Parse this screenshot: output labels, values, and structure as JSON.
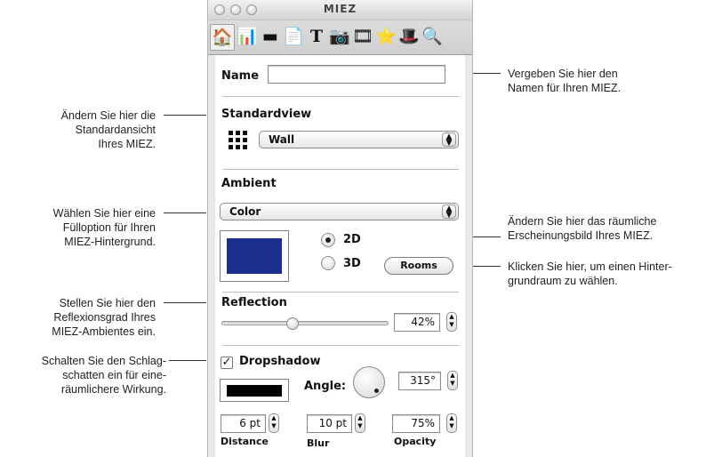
{
  "window": {
    "title": "MIEZ"
  },
  "toolbar": {
    "tools": [
      {
        "name": "home-tool",
        "glyph": "🏠",
        "selected": true
      },
      {
        "name": "floor-tool",
        "glyph": "📊",
        "selected": false
      },
      {
        "name": "table-tool",
        "glyph": "▬",
        "selected": false
      },
      {
        "name": "page-tool",
        "glyph": "📄",
        "selected": false
      },
      {
        "name": "text-tool",
        "glyph": "T",
        "selected": false
      },
      {
        "name": "photo-tool",
        "glyph": "📷",
        "selected": false
      },
      {
        "name": "film-tool",
        "glyph": "🎞",
        "selected": false
      },
      {
        "name": "star-tool",
        "glyph": "⭐",
        "selected": false
      },
      {
        "name": "magic-tool",
        "glyph": "🎩",
        "selected": false
      },
      {
        "name": "search-tool",
        "glyph": "🔍",
        "selected": false
      }
    ]
  },
  "panel": {
    "name_label": "Name",
    "name_value": "",
    "standardview_label": "Standardview",
    "standardview_value": "Wall",
    "ambient_label": "Ambient",
    "ambient_value": "Color",
    "ambient_color": "#1b2f8c",
    "radio_2d": "2D",
    "radio_3d": "3D",
    "radio_selected": "2D",
    "rooms_button": "Rooms",
    "reflection_label": "Reflection",
    "reflection_value": "42%",
    "reflection_level": 0.42,
    "dropshadow_label": "Dropshadow",
    "dropshadow_checked": true,
    "shadow_color": "#000000",
    "angle_label": "Angle:",
    "angle_value": "315°",
    "distance_value": "6 pt",
    "distance_label": "Distance",
    "blur_value": "10 pt",
    "blur_label": "Blur",
    "opacity_value": "75%",
    "opacity_label": "Opacity"
  },
  "annotations": {
    "name": "Vergeben Sie hier den\nNamen für Ihren MIEZ.",
    "standardview": "Ändern Sie hier die\nStandardansicht\nIhres MIEZ.",
    "ambient": "Wählen Sie hier eine\nFülloption für Ihren\nMIEZ-Hintergrund.",
    "dimension": "Ändern Sie hier das räumliche\nErscheinungsbild Ihres MIEZ.",
    "rooms": "Klicken Sie hier, um einen Hinter-\ngrundraum zu wählen.",
    "reflection": "Stellen Sie hier den\nReflexionsgrad Ihres\nMIEZ-Ambientes ein.",
    "dropshadow": "Schalten Sie den Schlag-\nschatten ein für eine-\nräumlichere Wirkung."
  }
}
